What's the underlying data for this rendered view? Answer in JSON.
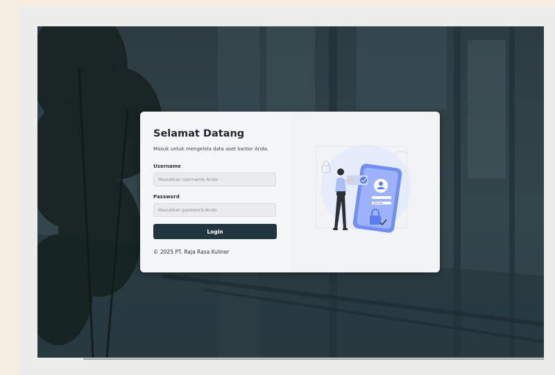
{
  "login": {
    "title": "Selamat Datang",
    "subtitle": "Masuk untuk mengelola data aset kantor Anda.",
    "username_label": "Username",
    "username_placeholder": "Masukkan username Anda",
    "password_label": "Password",
    "password_placeholder": "Masukkan password Anda",
    "login_button": "Login",
    "footer": "© 2025 PT. Raja Rasa Kuliner"
  },
  "colors": {
    "button": "#223640",
    "accent_illustration": "#5b7cf0",
    "background_overlay": "#2f4148"
  },
  "illustration": {
    "icon": "person-securing-phone-login-illustration"
  }
}
